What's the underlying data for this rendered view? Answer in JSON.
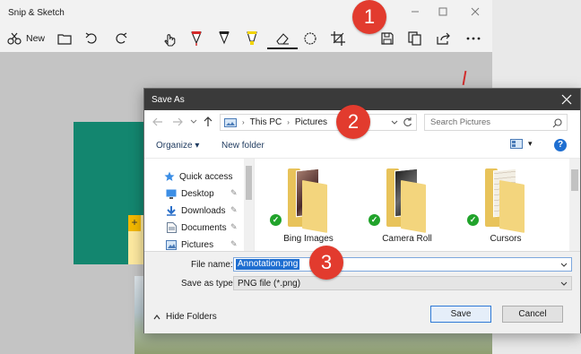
{
  "snip_window": {
    "title": "Snip & Sketch",
    "new_label": "New",
    "toolbar_icons": [
      "new-snip-icon",
      "open-file-icon",
      "undo-icon",
      "redo-icon",
      "touch-writing-icon",
      "ballpoint-pen-icon",
      "pencil-icon",
      "highlighter-icon",
      "eraser-icon",
      "ruler-icon",
      "crop-icon",
      "save-icon",
      "copy-icon",
      "share-icon",
      "more-icon"
    ]
  },
  "dialog": {
    "title": "Save As",
    "breadcrumb": [
      "This PC",
      "Pictures"
    ],
    "search_placeholder": "Search Pictures",
    "organize_label": "Organize",
    "new_folder_label": "New folder",
    "help_label": "?",
    "nav_items": [
      {
        "label": "Quick access",
        "icon": "star-icon"
      },
      {
        "label": "Desktop",
        "icon": "desktop-icon",
        "pinned": true
      },
      {
        "label": "Downloads",
        "icon": "downloads-icon",
        "pinned": true
      },
      {
        "label": "Documents",
        "icon": "documents-icon",
        "pinned": true
      },
      {
        "label": "Pictures",
        "icon": "pictures-icon",
        "pinned": true
      }
    ],
    "files": [
      {
        "name": "Bing Images",
        "photo": "#7a4b45"
      },
      {
        "name": "Camera Roll",
        "photo": "#3a3a3a"
      },
      {
        "name": "Cursors",
        "photo": "#f5f0e6"
      }
    ],
    "file_name_label": "File name:",
    "file_name_value": "Annotation.png",
    "save_type_label": "Save as type:",
    "save_type_value": "PNG file (*.png)",
    "hide_folders_label": "Hide Folders",
    "save_label": "Save",
    "cancel_label": "Cancel"
  },
  "callouts": [
    "1",
    "2",
    "3"
  ],
  "colors": {
    "callout": "#e23b2e",
    "selection": "#1f6fd1",
    "canvas_green": "#13866f",
    "dialog_titlebar": "#3a3a3a"
  }
}
